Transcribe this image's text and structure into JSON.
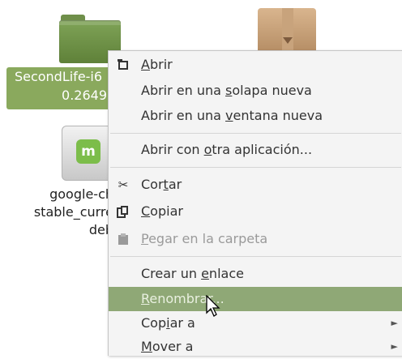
{
  "desktop": {
    "items": [
      {
        "label_line1": "SecondLife-i6",
        "label_line2": "0.2649"
      },
      {
        "label_line1": "google-ch",
        "label_line2": "stable_curre",
        "label_line3": "deb"
      }
    ]
  },
  "menu": {
    "items": [
      {
        "pre": "",
        "u": "A",
        "post": "brir"
      },
      {
        "pre": "Abrir en una ",
        "u": "s",
        "post": "olapa nueva"
      },
      {
        "pre": "Abrir en una ",
        "u": "v",
        "post": "entana nueva"
      },
      {
        "pre": "Abrir con ",
        "u": "o",
        "post": "tra aplicación..."
      },
      {
        "pre": "Cor",
        "u": "t",
        "post": "ar"
      },
      {
        "pre": "",
        "u": "C",
        "post": "opiar"
      },
      {
        "pre": "",
        "u": "P",
        "post": "egar en la carpeta"
      },
      {
        "pre": "Crear un ",
        "u": "e",
        "post": "nlace"
      },
      {
        "pre": "",
        "u": "R",
        "post": "enombrar..."
      },
      {
        "pre": "Cop",
        "u": "i",
        "post": "ar a"
      },
      {
        "pre": "",
        "u": "M",
        "post": "over a"
      }
    ],
    "submenu_arrow": "►"
  }
}
